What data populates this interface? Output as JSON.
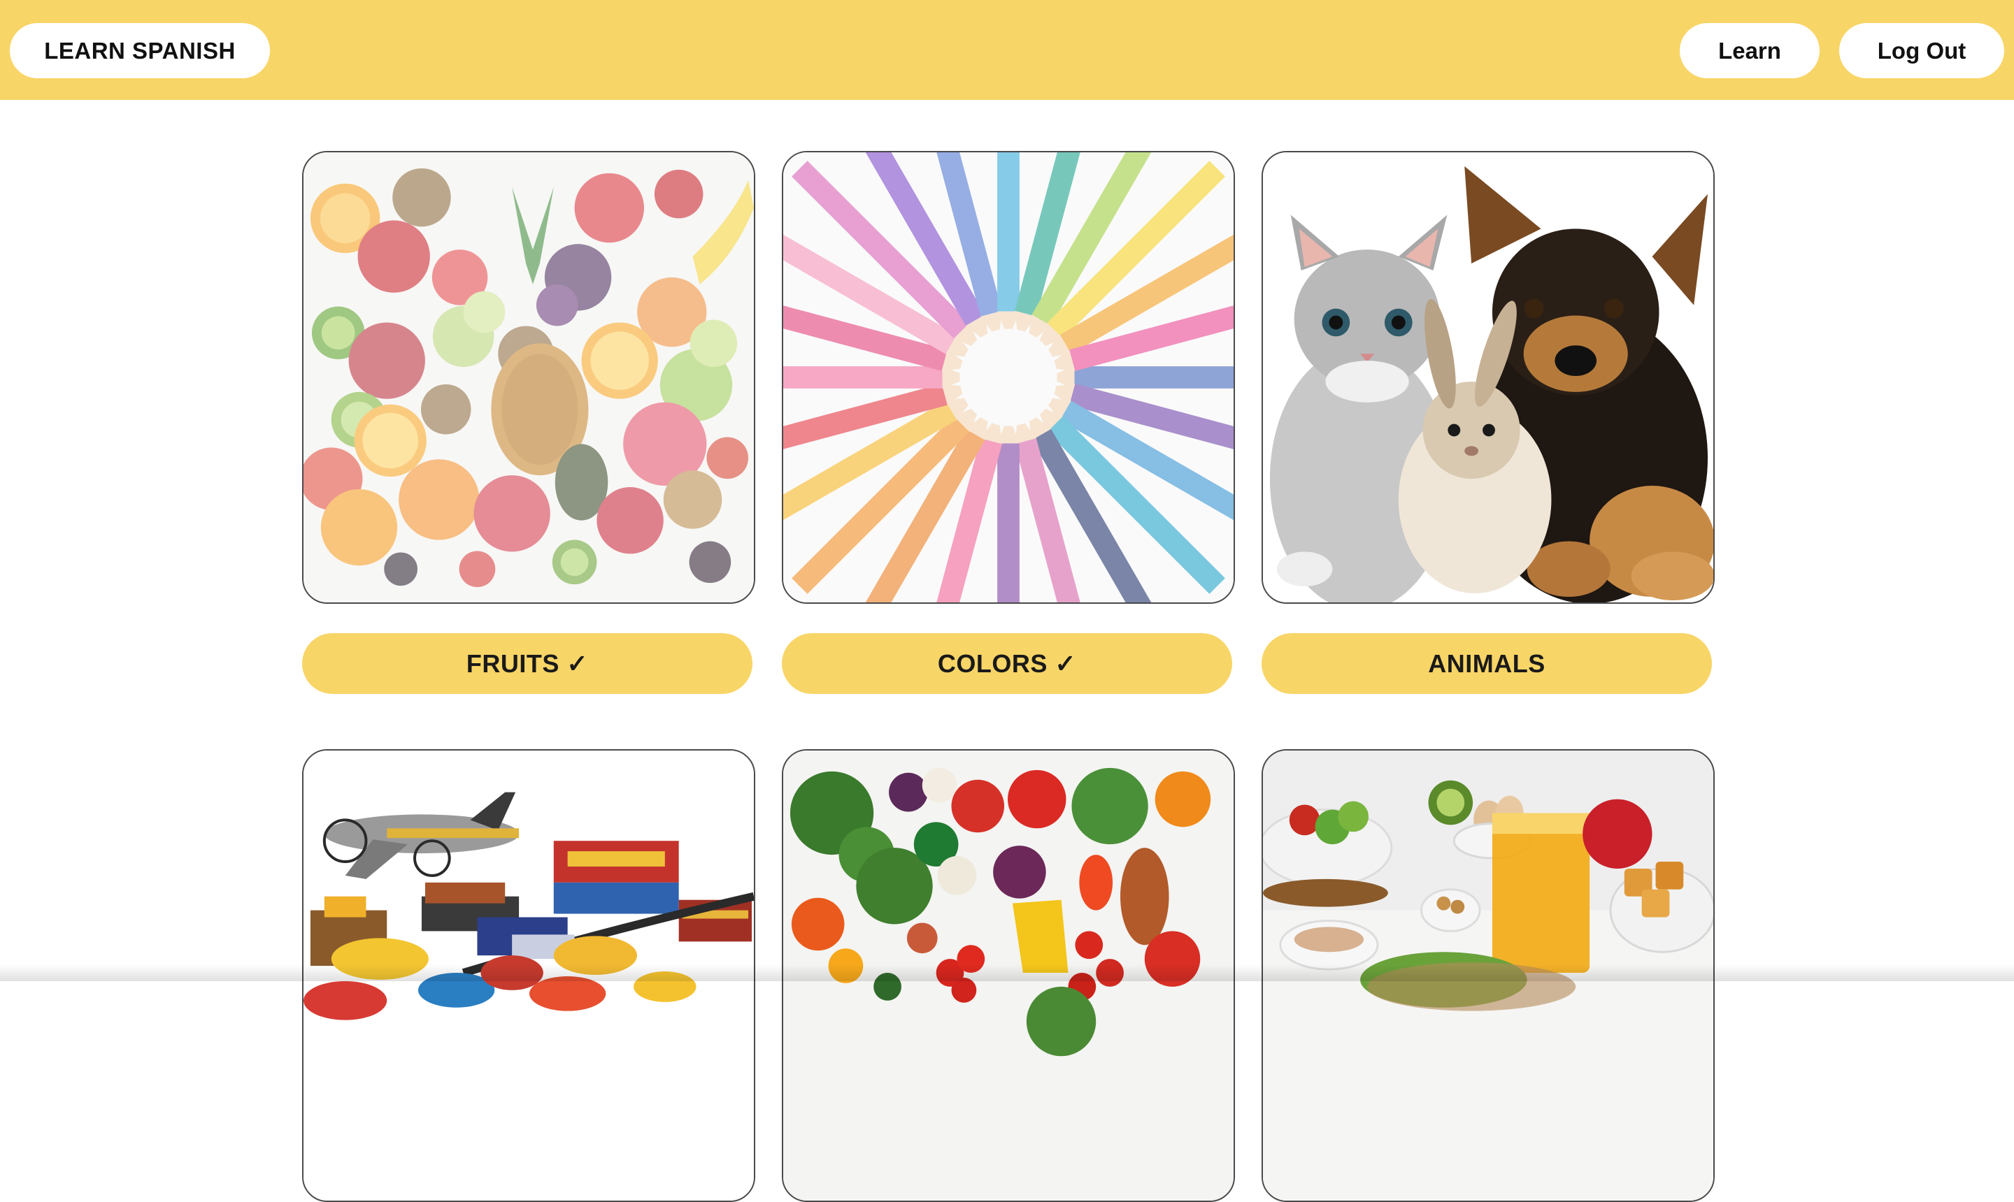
{
  "header": {
    "brand_label": "LEARN SPANISH",
    "nav": {
      "learn_label": "Learn",
      "logout_label": "Log Out"
    }
  },
  "categories": [
    {
      "label": "FRUITS ✓",
      "completed": true,
      "image": "fruits-photo"
    },
    {
      "label": "COLORS ✓",
      "completed": true,
      "image": "colored-pencils-photo"
    },
    {
      "label": "ANIMALS",
      "completed": false,
      "image": "cat-rabbit-puppy-photo"
    },
    {
      "label": "",
      "completed": false,
      "image": "toys-photo"
    },
    {
      "label": "",
      "completed": false,
      "image": "vegetables-photo"
    },
    {
      "label": "",
      "completed": false,
      "image": "breakfast-food-photo"
    }
  ],
  "colors": {
    "accent": "#f8d567",
    "surface": "#ffffff",
    "text": "#111111"
  }
}
